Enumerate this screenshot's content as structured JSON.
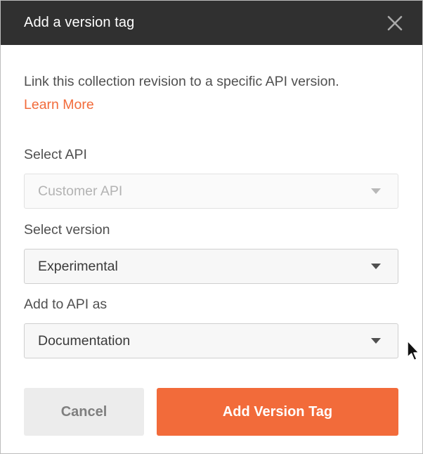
{
  "dialog": {
    "title": "Add a version tag",
    "description": "Link this collection revision to a specific API version.",
    "learn_more": "Learn More"
  },
  "fields": {
    "select_api": {
      "label": "Select API",
      "value": "Customer API",
      "disabled": true
    },
    "select_version": {
      "label": "Select version",
      "value": "Experimental"
    },
    "add_to_api_as": {
      "label": "Add to API as",
      "value": "Documentation"
    }
  },
  "buttons": {
    "cancel": "Cancel",
    "add_version_tag": "Add Version Tag"
  },
  "colors": {
    "header_bg": "#303030",
    "accent": "#f26b3a",
    "cancel_bg": "#ececec"
  },
  "icons": {
    "close": "close-icon",
    "caret": "chevron-down-icon",
    "cursor": "mouse-pointer-icon"
  }
}
